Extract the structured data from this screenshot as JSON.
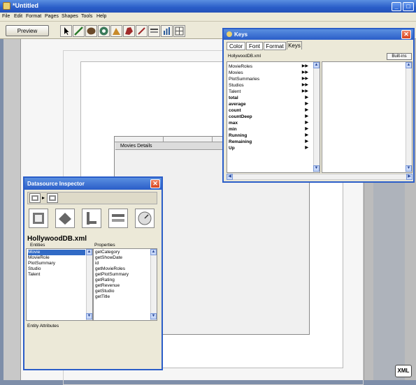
{
  "window": {
    "title": "*Untitled"
  },
  "menus": [
    "File",
    "Edit",
    "Format",
    "Pages",
    "Shapes",
    "Tools",
    "Help"
  ],
  "toolbar": {
    "preview_label": "Preview"
  },
  "canvas": {
    "movie_details_label": "Movies Details",
    "xml_badge": "XML"
  },
  "keys_palette": {
    "title": "Keys",
    "tabs": [
      "Color",
      "Font",
      "Format",
      "Keys"
    ],
    "active_tab": "Keys",
    "file": "HollywoodDB.xml",
    "builtins_label": "Built-ins",
    "keys": [
      {
        "label": "MovieRoles",
        "arrow": "▶▶",
        "bold": false
      },
      {
        "label": "Movies",
        "arrow": "▶▶",
        "bold": false
      },
      {
        "label": "PlotSummaries",
        "arrow": "▶▶",
        "bold": false
      },
      {
        "label": "Studios",
        "arrow": "▶▶",
        "bold": false
      },
      {
        "label": "Talent",
        "arrow": "▶▶",
        "bold": false
      },
      {
        "label": "total",
        "arrow": "▶",
        "bold": true
      },
      {
        "label": "average",
        "arrow": "▶",
        "bold": true
      },
      {
        "label": "count",
        "arrow": "▶",
        "bold": true
      },
      {
        "label": "countDeep",
        "arrow": "▶",
        "bold": true
      },
      {
        "label": "max",
        "arrow": "▶",
        "bold": true
      },
      {
        "label": "min",
        "arrow": "▶",
        "bold": true
      },
      {
        "label": "Running",
        "arrow": "▶",
        "bold": true
      },
      {
        "label": "Remaining",
        "arrow": "▶",
        "bold": true
      },
      {
        "label": "Up",
        "arrow": "▶",
        "bold": true
      }
    ]
  },
  "inspector": {
    "title": "Datasource Inspector",
    "source": "HollywoodDB.xml",
    "entities_header": "Entities",
    "properties_header": "Properties",
    "entities": [
      "Movie",
      "MovieRole",
      "PlotSummary",
      "Studio",
      "Talent"
    ],
    "selected_entity": "Movie",
    "properties": [
      "getCategory",
      "getShowDate",
      "id",
      "getMovieRoles",
      "getPlotSummary",
      "getRating",
      "getRevenue",
      "getStudio",
      "getTitle"
    ],
    "footer": "Entity Attributes"
  },
  "colors": {
    "titlebar": "#2a5dc8",
    "selection": "#316ac5",
    "panel": "#ece9d8"
  }
}
